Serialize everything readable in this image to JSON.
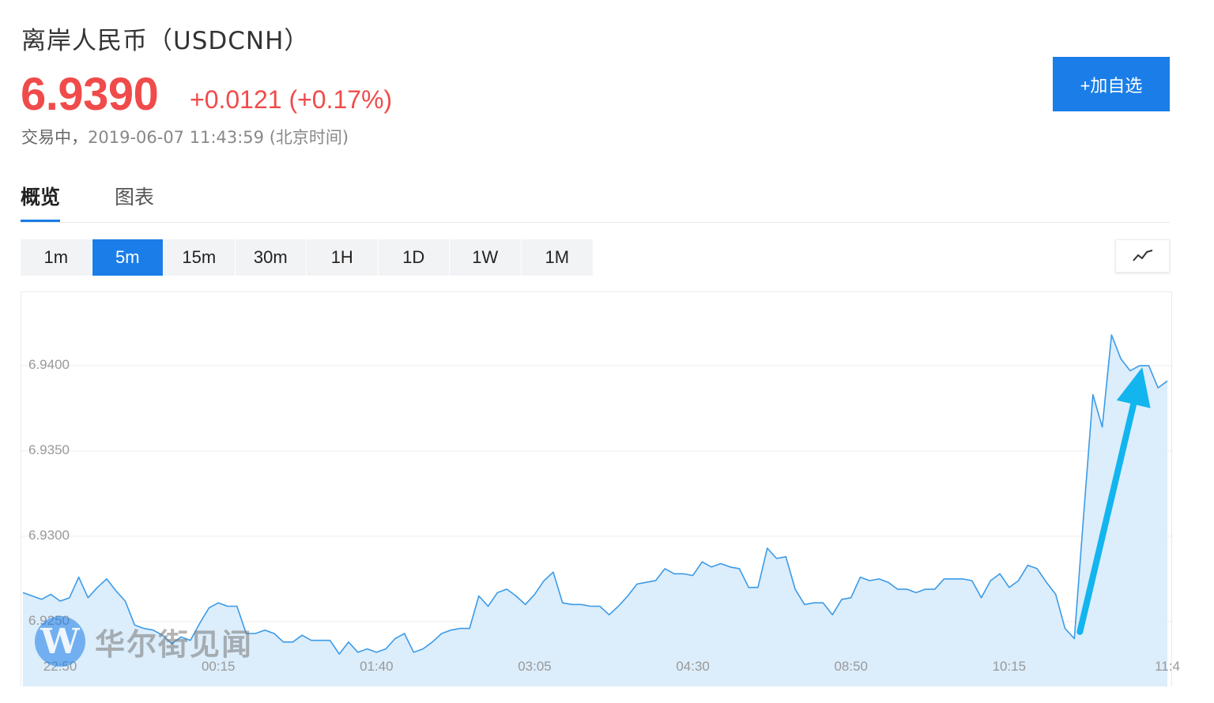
{
  "header": {
    "title": "离岸人民币（USDCNH）",
    "price": "6.9390",
    "change": "+0.0121 (+0.17%)",
    "status_prefix": "交易中，",
    "timestamp": "2019-06-07 11:43:59 (北京时间)",
    "add_watchlist_label": "+加自选"
  },
  "tabs": [
    {
      "label": "概览",
      "active": true
    },
    {
      "label": "图表",
      "active": false
    }
  ],
  "periods": [
    {
      "label": "1m",
      "active": false
    },
    {
      "label": "5m",
      "active": true
    },
    {
      "label": "15m",
      "active": false
    },
    {
      "label": "30m",
      "active": false
    },
    {
      "label": "1H",
      "active": false
    },
    {
      "label": "1D",
      "active": false
    },
    {
      "label": "1W",
      "active": false
    },
    {
      "label": "1M",
      "active": false
    }
  ],
  "chart_type_icon": "line-chart-icon",
  "watermark": {
    "logo": "W",
    "text": "华尔街见闻"
  },
  "colors": {
    "accent": "#1a7de8",
    "up": "#f04b4b",
    "line": "#3b9be8",
    "area": "#dcedfb",
    "arrow": "#12b5ee"
  },
  "chart_data": {
    "type": "area",
    "ylim": [
      6.9212,
      6.9443
    ],
    "yticks": [
      "6.9400",
      "6.9350",
      "6.9300",
      "6.9250"
    ],
    "xticks": [
      {
        "label": "22:50",
        "i": 4
      },
      {
        "label": "00:15",
        "i": 21
      },
      {
        "label": "01:40",
        "i": 38
      },
      {
        "label": "03:05",
        "i": 55
      },
      {
        "label": "04:30",
        "i": 72
      },
      {
        "label": "08:50",
        "i": 89
      },
      {
        "label": "10:15",
        "i": 106
      },
      {
        "label": "11:4",
        "i": 123
      }
    ],
    "grid": true,
    "series": [
      {
        "values": [
          6.9267,
          6.9265,
          6.9263,
          6.9266,
          6.9262,
          6.9264,
          6.9276,
          6.9264,
          6.927,
          6.9275,
          6.9268,
          6.9262,
          6.9248,
          6.9246,
          6.9245,
          6.9242,
          6.9237,
          6.9241,
          6.9239,
          6.9249,
          6.9258,
          6.9261,
          6.9259,
          6.9259,
          6.9243,
          6.9243,
          6.9245,
          6.9243,
          6.9238,
          6.9238,
          6.9242,
          6.9239,
          6.9239,
          6.9239,
          6.9231,
          6.9238,
          6.9232,
          6.9234,
          6.9232,
          6.9234,
          6.924,
          6.9243,
          6.9232,
          6.9234,
          6.9238,
          6.9243,
          6.9245,
          6.9246,
          6.9246,
          6.9265,
          6.9259,
          6.9267,
          6.9269,
          6.9265,
          6.926,
          6.9266,
          6.9274,
          6.9279,
          6.9261,
          6.926,
          6.926,
          6.9259,
          6.9259,
          6.9254,
          6.9259,
          6.9265,
          6.9272,
          6.9273,
          6.9274,
          6.9281,
          6.9278,
          6.9278,
          6.9277,
          6.9285,
          6.9282,
          6.9284,
          6.9282,
          6.9281,
          6.927,
          6.927,
          6.9293,
          6.9287,
          6.9288,
          6.9269,
          6.926,
          6.9261,
          6.9261,
          6.9254,
          6.9263,
          6.9264,
          6.9276,
          6.9274,
          6.9275,
          6.9273,
          6.9269,
          6.9269,
          6.9267,
          6.9269,
          6.9269,
          6.9275,
          6.9275,
          6.9275,
          6.9274,
          6.9264,
          6.9274,
          6.9278,
          6.927,
          6.9274,
          6.9283,
          6.9281,
          6.9273,
          6.9266,
          6.9246,
          6.924,
          6.9312,
          6.9383,
          6.9364,
          6.9418,
          6.9404,
          6.9397,
          6.94,
          6.94,
          6.9387,
          6.9391
        ]
      }
    ],
    "annotations": [
      {
        "type": "arrow",
        "from_i": 113.6,
        "from_y": 6.9244,
        "to_i": 120.3,
        "to_y": 6.9399
      }
    ]
  }
}
